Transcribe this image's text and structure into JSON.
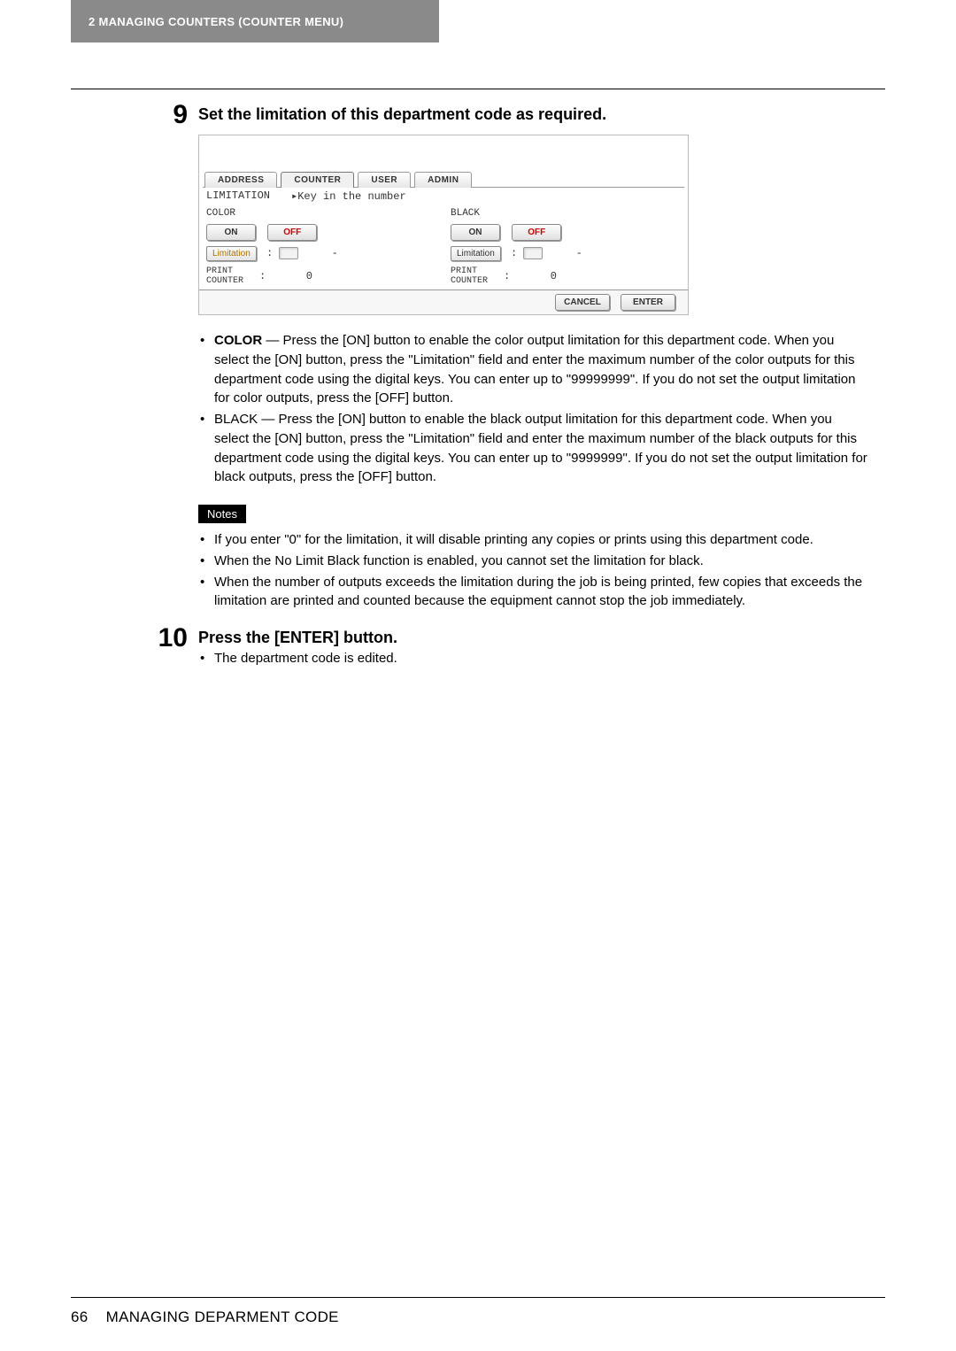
{
  "header": {
    "chapter_label": "2   MANAGING COUNTERS (COUNTER MENU)"
  },
  "step9": {
    "number": "9",
    "title": "Set the limitation of this department code as required.",
    "panel": {
      "tabs": {
        "address": "ADDRESS",
        "counter": "COUNTER",
        "user": "USER",
        "admin": "ADMIN"
      },
      "status_line": {
        "label": "LIMITATION",
        "hint": "▸Key in the number"
      },
      "left": {
        "heading": "COLOR",
        "on": "ON",
        "off": "OFF",
        "limitation_label": "Limitation",
        "limitation_sep": ":",
        "limitation_value": "-",
        "print_counter_label": "PRINT\nCOUNTER",
        "pc_sep": ":",
        "pc_value": "0"
      },
      "right": {
        "heading": "BLACK",
        "on": "ON",
        "off": "OFF",
        "limitation_label": "Limitation",
        "limitation_sep": ":",
        "limitation_value": "-",
        "print_counter_label": "PRINT\nCOUNTER",
        "pc_sep": ":",
        "pc_value": "0"
      },
      "footer": {
        "cancel": "CANCEL",
        "enter": "ENTER"
      }
    },
    "bullets": {
      "color_label": "COLOR",
      "color_text": " — Press the [ON] button to enable the color output limitation for this department code. When you select the [ON] button, press the \"Limitation\" field and enter the maximum number of the color outputs for this department code using the digital keys. You can enter up to \"99999999\". If you do not set the output limitation for color outputs, press the [OFF] button.",
      "black_text": "BLACK — Press the [ON] button to enable the black output limitation for this department code. When you select the [ON] button, press the \"Limitation\" field and enter the maximum number of the black outputs for this department code using the digital keys. You can enter up to \"9999999\". If you do not set the output limitation for black outputs, press the [OFF] button."
    },
    "notes": {
      "label": "Notes",
      "items": [
        "If you enter \"0\" for the limitation, it will disable printing any copies or prints using this department code.",
        "When the No Limit Black function is enabled, you cannot set the limitation for black.",
        "When the number of outputs exceeds the limitation during the job is being printed, few copies that exceeds the limitation are printed and counted because the equipment cannot stop the job immediately."
      ]
    }
  },
  "step10": {
    "number": "10",
    "title": "Press the [ENTER] button.",
    "bullet": "The department code is edited."
  },
  "footer": {
    "page": "66",
    "title": "MANAGING DEPARMENT CODE"
  }
}
